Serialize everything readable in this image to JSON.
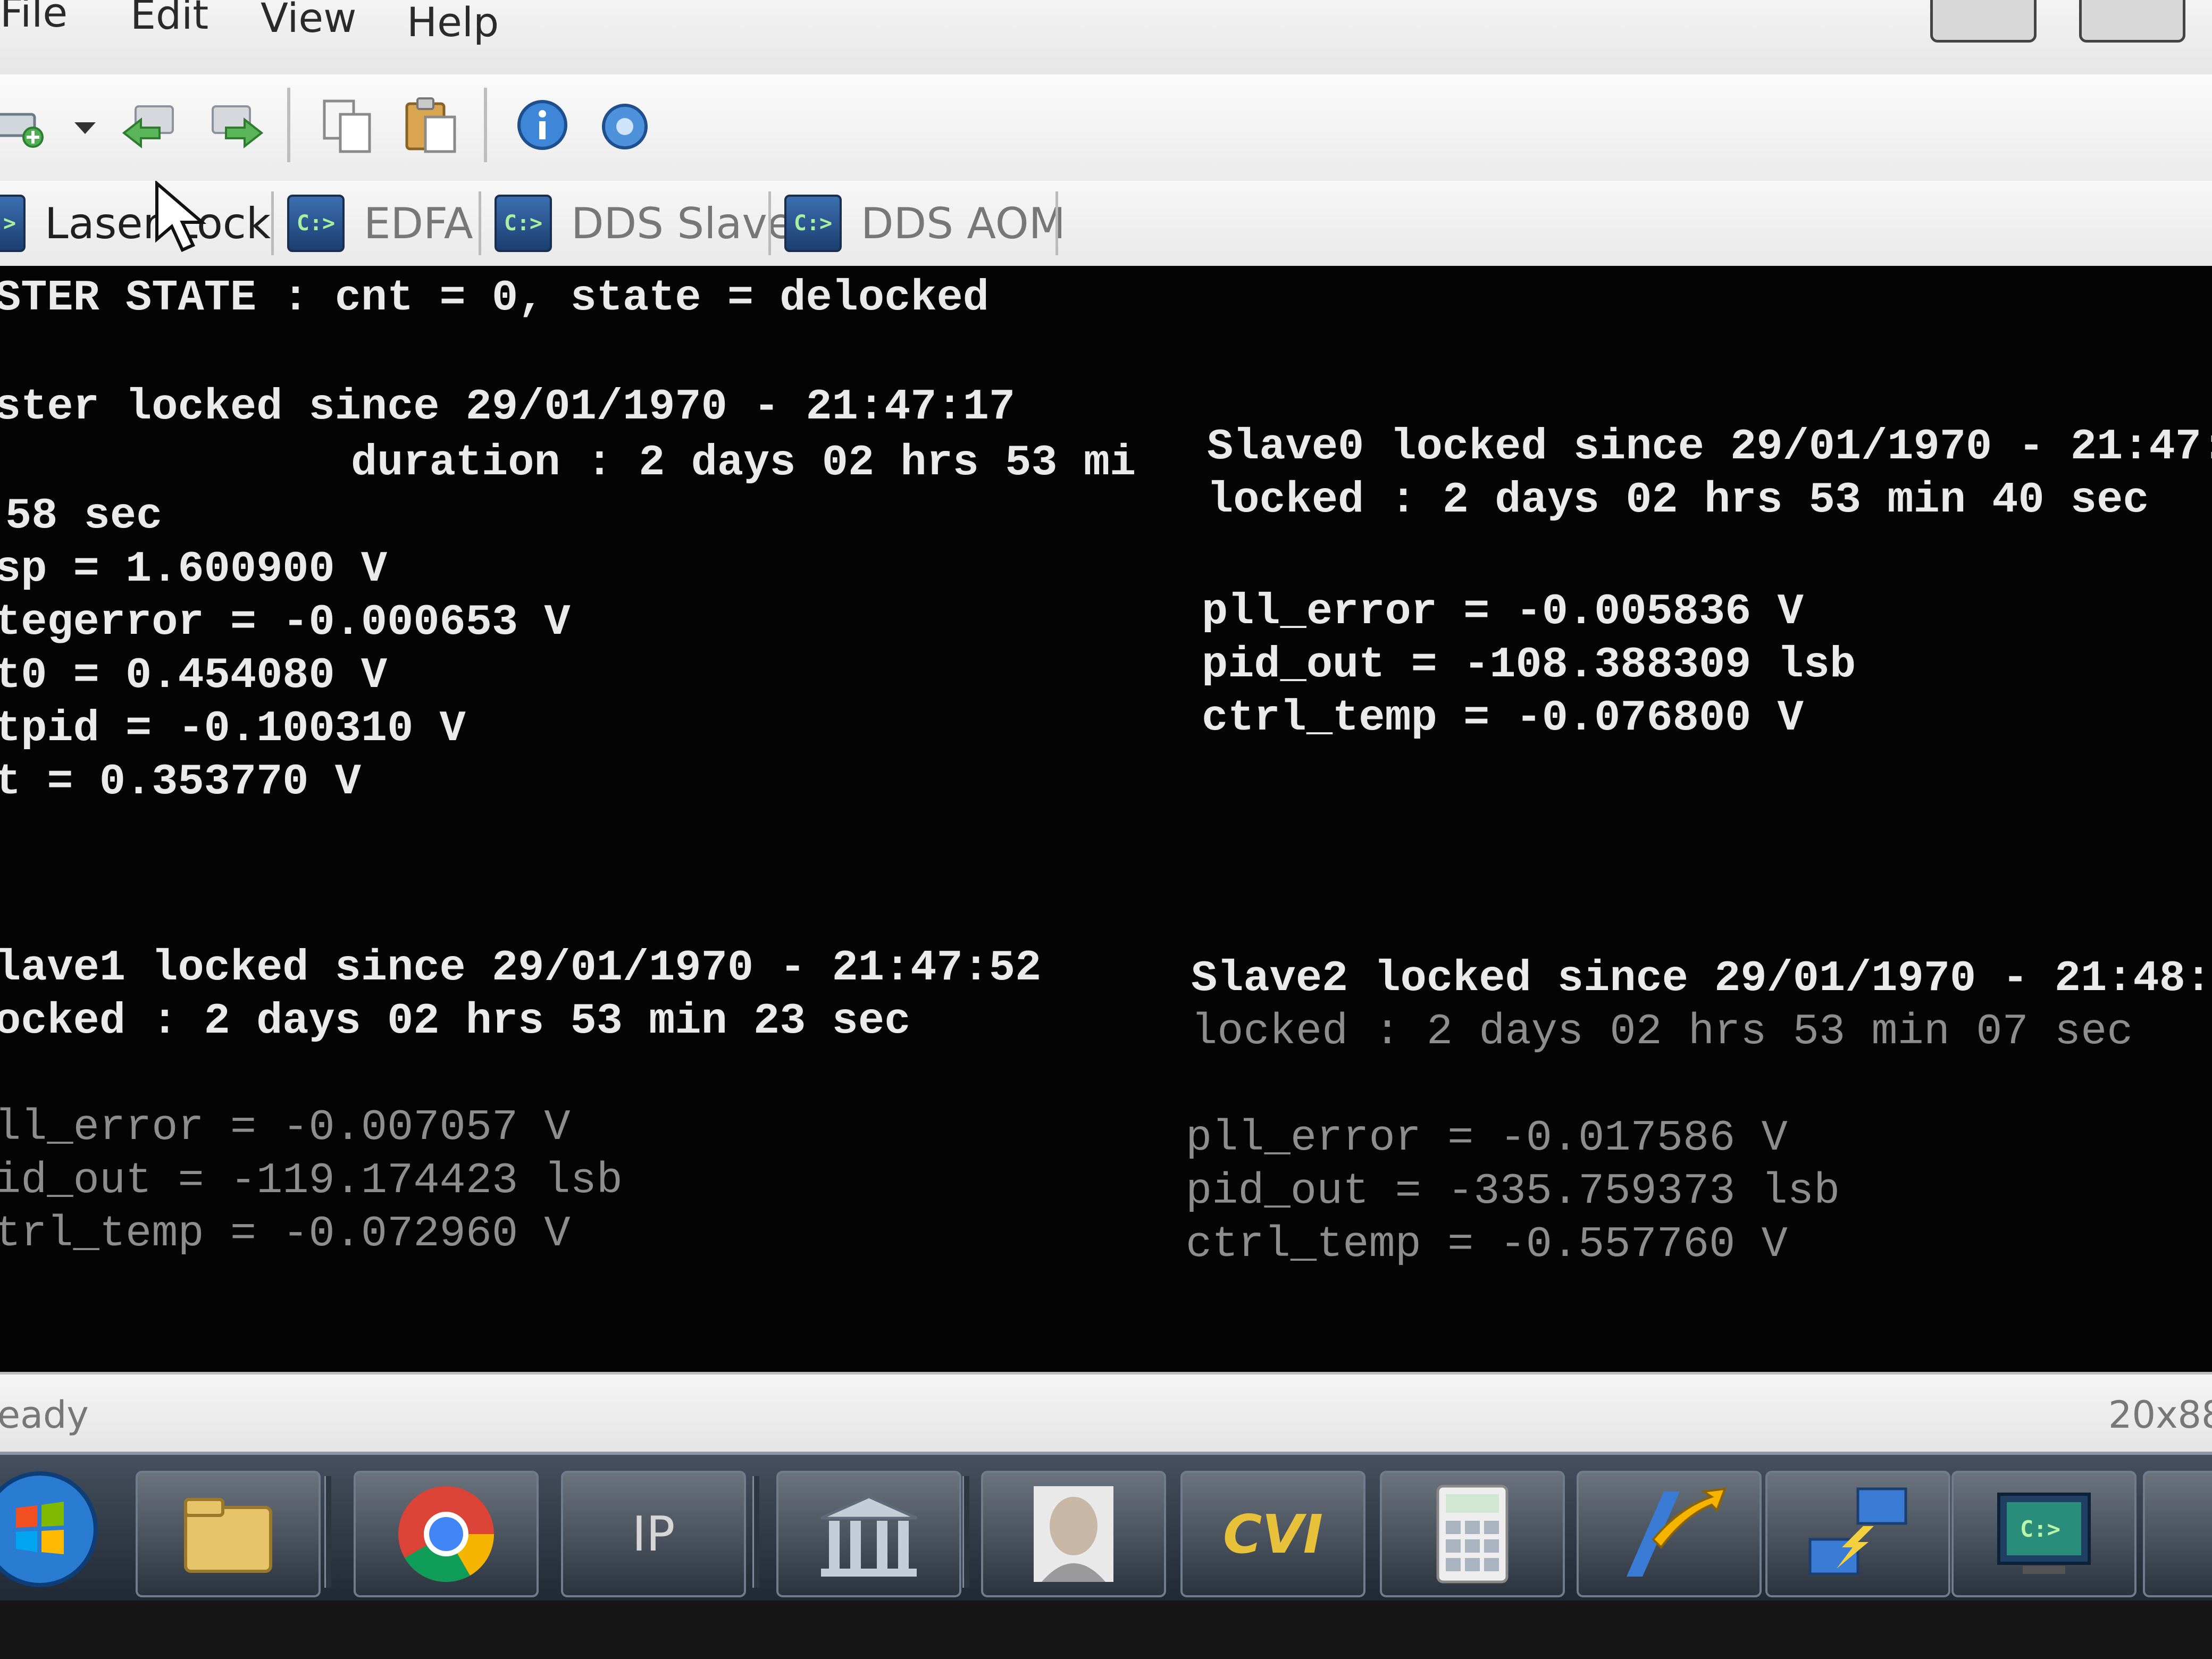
{
  "menu": {
    "file": "File",
    "edit": "Edit",
    "view": "View",
    "help": "Help"
  },
  "toolbar": {
    "icons": [
      "new-connection-icon",
      "dropdown-arrow-icon",
      "back-arrow-icon",
      "forward-arrow-icon",
      "copy-icon",
      "paste-icon",
      "info-icon",
      "help-globe-icon"
    ]
  },
  "tabs": [
    {
      "label": "Laser Lock",
      "active": true
    },
    {
      "label": "EDFA",
      "active": false
    },
    {
      "label": "DDS Slave",
      "active": false
    },
    {
      "label": "DDS AOM",
      "active": false
    }
  ],
  "tab_icon_glyph": "C:>",
  "console": {
    "master_state": "STER STATE : cnt = 0, state = delocked",
    "master": {
      "locked_since": "ster locked since 29/01/1970 - 21:47:17",
      "duration": "duration : 2 days 02 hrs 53 mi",
      "duration_cont": "58 sec",
      "sp": "sp = 1.600900 V",
      "integerror": "tegerror = -0.000653 V",
      "out0": "t0 = 0.454080 V",
      "outpid": "tpid = -0.100310 V",
      "out": "t = 0.353770 V"
    },
    "slave0": {
      "locked_since": "Slave0 locked since 29/01/1970 - 21:47:",
      "locked": "locked : 2 days 02 hrs 53 min 40 sec",
      "pll_error": "pll_error = -0.005836 V",
      "pid_out": "pid_out = -108.388309 lsb",
      "ctrl_temp": "ctrl_temp = -0.076800 V"
    },
    "slave1": {
      "locked_since": "lave1 locked since 29/01/1970 - 21:47:52",
      "locked": "ocked : 2 days 02 hrs 53 min 23 sec",
      "pll_error": "ll_error = -0.007057 V",
      "pid_out": "id_out = -119.174423 lsb",
      "ctrl_temp": "trl_temp = -0.072960 V"
    },
    "slave2": {
      "locked_since": "Slave2 locked since 29/01/1970 - 21:48:0",
      "locked": "locked : 2 days 02 hrs 53 min 07 sec",
      "pll_error": "pll_error = -0.017586 V",
      "pid_out": "pid_out = -335.759373 lsb",
      "ctrl_temp": "ctrl_temp = -0.557760 V"
    }
  },
  "status": {
    "left": "eady",
    "right": "20x88"
  },
  "taskbar": {
    "items": [
      "start-orb-icon",
      "file-explorer-icon",
      "chrome-icon",
      "ip-viewer-icon",
      "library-icon",
      "portrait-app-icon",
      "cvi-icon",
      "calculator-icon",
      "arrow-tool-icon",
      "network-icon",
      "console-icon"
    ],
    "ip_label": "IP",
    "cvi_label": "CVI",
    "console_glyph": "C:>"
  },
  "colors": {
    "console_bg": "#050404",
    "console_text": "#eaeaea",
    "console_dim_text": "#8d8d8d",
    "tab_icon_bg": "#2a5590"
  }
}
